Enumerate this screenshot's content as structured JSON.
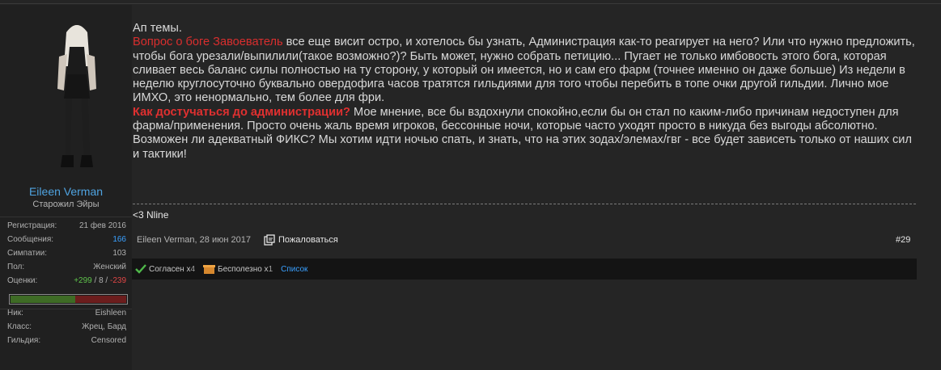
{
  "user": {
    "name": "Eileen Verman",
    "title": "Старожил Эйры",
    "stats": [
      {
        "label": "Регистрация:",
        "value": "21 фев 2016"
      },
      {
        "label": "Сообщения:",
        "value": "166"
      },
      {
        "label": "Симпатии:",
        "value": "103"
      },
      {
        "label": "Пол:",
        "value": "Женский"
      }
    ],
    "ratings": {
      "label": "Оценки:",
      "positive": "+299",
      "sep1": " / ",
      "neutral": "8",
      "sep2": " / ",
      "negative": "-239"
    },
    "rep_positive_fraction": 0.56,
    "game": [
      {
        "label": "Ник:",
        "value": "Eishleen"
      },
      {
        "label": "Класс:",
        "value": "Жрец, Бард"
      },
      {
        "label": "Гильдия:",
        "value": "Censored"
      }
    ]
  },
  "post": {
    "line1": "Ап темы.",
    "p1_red": "Вопрос о боге Завоеватель",
    "p1_text": " все еще висит остро, и хотелось бы узнать, Администрация как-то реагирует на него? Или что нужно предложить, чтобы бога урезали/выпилили(такое возможно?)? Быть может, нужно собрать петицию... Пугает не только имбовость этого бога, которая сливает весь баланс силы полностью на ту сторону, у который он имеется, но и сам его фарм (точнее именно он даже больше) Из недели в неделю круглосуточно буквально овердофига часов тратятся гильдиями для того чтобы перебить в топе очки другой гильдии. Лично мое ИМХО, это ненормально, тем более для фри.",
    "p2_red": "Как достучаться до администрации?",
    "p2_text": " Мое мнение, все бы вздохнули спокойно,если бы он стал по каким-либо причинам недоступен для фарма/применения. Просто очень жаль время игроков, бессонные ночи, которые часто уходят просто в никуда без выгоды абсолютно.",
    "p3": "Возможен ли адекватный ФИКС? Мы хотим идти ночью спать, и знать, что на этих зодах/элемах/гвг - все будет зависеть только от наших сил и тактики!",
    "signature": "<3 Nline",
    "meta": "Eileen Verman, 28 июн 2017",
    "report_label": "Пожаловаться",
    "post_number": "#29"
  },
  "reactions": {
    "agree_label": "Согласен x ",
    "agree_count": "4",
    "useless_label": "Бесполезно x ",
    "useless_count": "1",
    "list_label": "Список"
  },
  "colors": {
    "accent_blue": "#3aa0ff",
    "red": "#d92e2e",
    "green": "#5ec24b",
    "bg": "#252525"
  }
}
